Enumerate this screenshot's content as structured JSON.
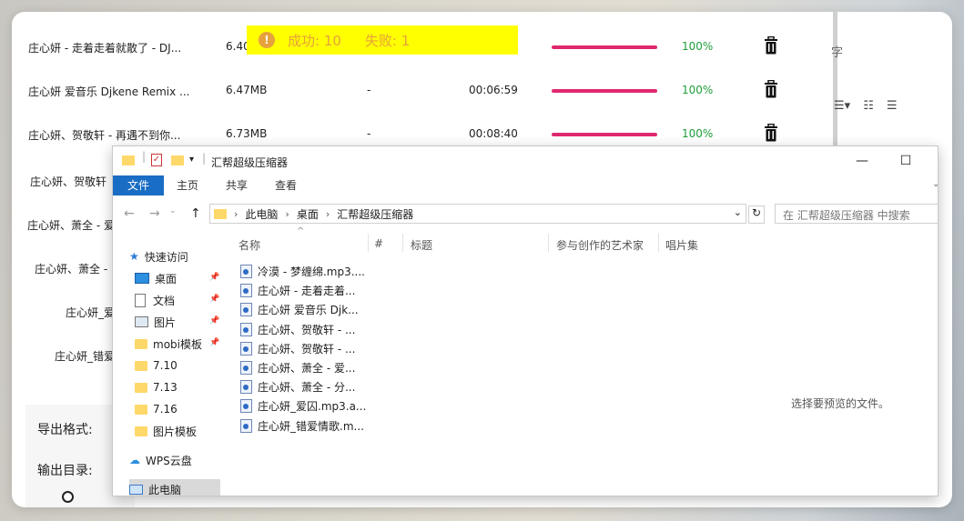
{
  "bg_app": {
    "rows": [
      {
        "name": "庄心妍 - 走着走着就散了 - DJ...",
        "size": "6.40",
        "dash": "",
        "duration": "",
        "pct": "100%"
      },
      {
        "name": "庄心妍 爱音乐 Djkene Remix ...",
        "size": "6.47MB",
        "dash": "-",
        "duration": "00:06:59",
        "pct": "100%"
      },
      {
        "name": "庄心妍、贺敬轩 - 再遇不到你...",
        "size": "6.73MB",
        "dash": "-",
        "duration": "00:08:40",
        "pct": "100%"
      }
    ],
    "partial_names": [
      "庄心妍、贺敬轩",
      "庄心妍、萧全 - 爱",
      "庄心妍、萧全 -",
      "庄心妍_爱",
      "庄心妍_错爱"
    ],
    "right_char": "字",
    "export_format_label": "导出格式:",
    "output_dir_label": "输出目录:"
  },
  "toast": {
    "success": "成功: 10",
    "fail": "失败: 1",
    "icon": "!"
  },
  "explorer": {
    "title": "汇帮超级压缩器",
    "ribbon_tabs": [
      "文件",
      "主页",
      "共享",
      "查看"
    ],
    "breadcrumb": [
      "此电脑",
      "桌面",
      "汇帮超级压缩器"
    ],
    "search_placeholder": "在 汇帮超级压缩器 中搜索",
    "nav": [
      {
        "label": "快速访问",
        "kind": "star"
      },
      {
        "label": "桌面",
        "kind": "desktop",
        "pinned": true
      },
      {
        "label": "文档",
        "kind": "doc",
        "pinned": true
      },
      {
        "label": "图片",
        "kind": "pic",
        "pinned": true
      },
      {
        "label": "mobi模板",
        "kind": "folder",
        "pinned": true
      },
      {
        "label": "7.10",
        "kind": "folder"
      },
      {
        "label": "7.13",
        "kind": "folder"
      },
      {
        "label": "7.16",
        "kind": "folder"
      },
      {
        "label": "图片模板",
        "kind": "folder"
      },
      {
        "label": "WPS云盘",
        "kind": "cloud"
      },
      {
        "label": "此电脑",
        "kind": "pc"
      }
    ],
    "columns": [
      "名称",
      "#",
      "标题",
      "参与创作的艺术家",
      "唱片集"
    ],
    "files": [
      "冷漠 - 梦缠绵.mp3....",
      "庄心妍 - 走着走着...",
      "庄心妍 爱音乐 Djk...",
      "庄心妍、贺敬轩 - ...",
      "庄心妍、贺敬轩 - ...",
      "庄心妍、萧全 - 爱...",
      "庄心妍、萧全 - 分...",
      "庄心妍_爱囚.mp3.a...",
      "庄心妍_错爱情歌.m..."
    ],
    "preview_text": "选择要预览的文件。"
  }
}
